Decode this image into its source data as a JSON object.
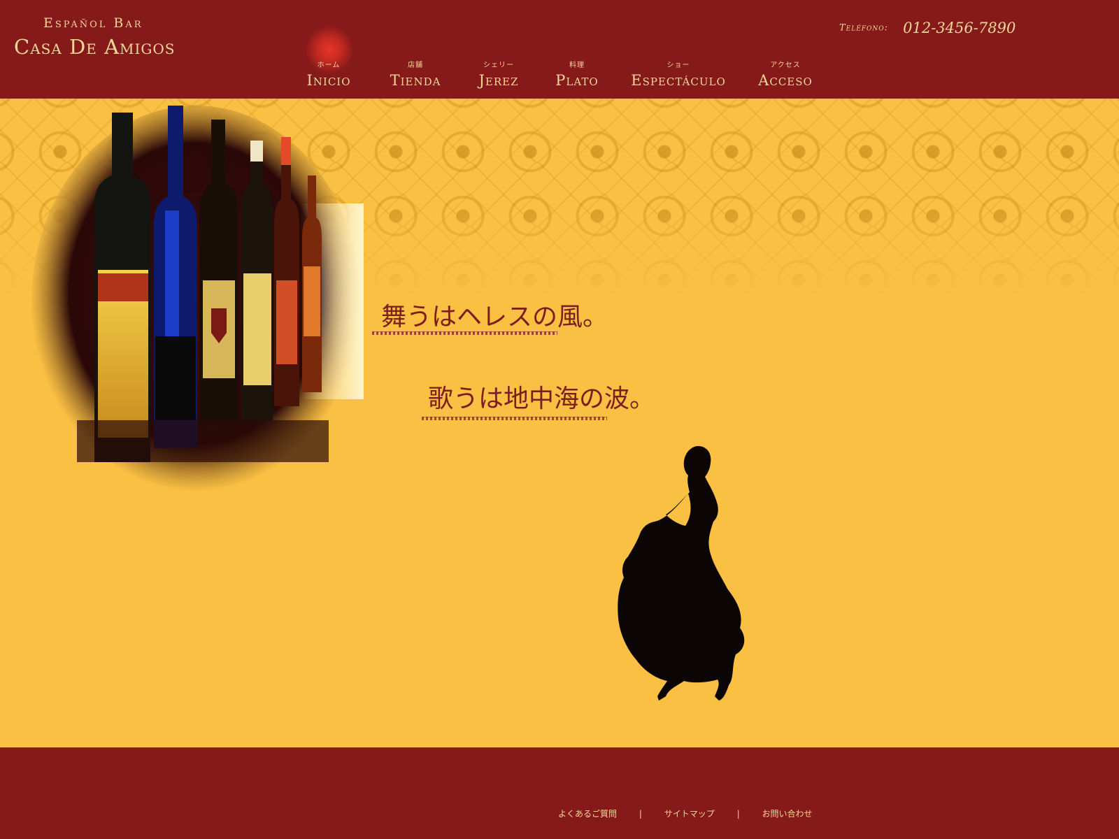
{
  "brand": {
    "subtitle": "Español Bar",
    "name": "Casa De Amigos"
  },
  "phone": {
    "label": "Teléfono:",
    "number": "012-3456-7890"
  },
  "nav": {
    "items": [
      {
        "sub": "ホーム",
        "label": "Inicio",
        "active": true
      },
      {
        "sub": "店舗",
        "label": "Tienda",
        "active": false
      },
      {
        "sub": "シェリー",
        "label": "Jerez",
        "active": false
      },
      {
        "sub": "料理",
        "label": "Plato",
        "active": false
      },
      {
        "sub": "ショー",
        "label": "Espectáculo",
        "active": false
      },
      {
        "sub": "アクセス",
        "label": "Acceso",
        "active": false
      }
    ]
  },
  "hero": {
    "tagline_1": "舞うはヘレスの風。",
    "tagline_2": "歌うは地中海の波。"
  },
  "footer": {
    "links": [
      "よくあるご質問",
      "サイトマップ",
      "お問い合わせ"
    ],
    "separator": "|"
  },
  "colors": {
    "header_bg": "#861a1a",
    "hero_bg": "#f9c043",
    "text_gold": "#f3d79a",
    "tagline": "#7d1e1e"
  }
}
